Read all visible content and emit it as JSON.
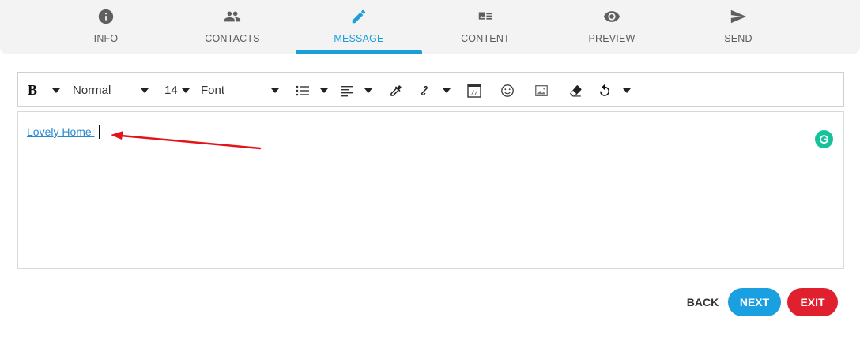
{
  "steps": [
    {
      "label": "INFO",
      "icon": "info-icon"
    },
    {
      "label": "CONTACTS",
      "icon": "people-icon"
    },
    {
      "label": "MESSAGE",
      "icon": "pencil-icon",
      "active": true
    },
    {
      "label": "CONTENT",
      "icon": "content-icon"
    },
    {
      "label": "PREVIEW",
      "icon": "eye-icon"
    },
    {
      "label": "SEND",
      "icon": "send-icon"
    }
  ],
  "toolbar": {
    "bold_label": "B",
    "paragraph_style": "Normal",
    "font_size": "14",
    "font_family": "Font"
  },
  "editor": {
    "content_link": "Lovely Home "
  },
  "actions": {
    "back_label": "BACK",
    "next_label": "NEXT",
    "exit_label": "EXIT"
  },
  "colors": {
    "accent": "#1a9fd9",
    "next": "#1a9fe0",
    "exit": "#e0202e",
    "grammarly": "#15c39a",
    "annotation_arrow": "#e3151a"
  }
}
